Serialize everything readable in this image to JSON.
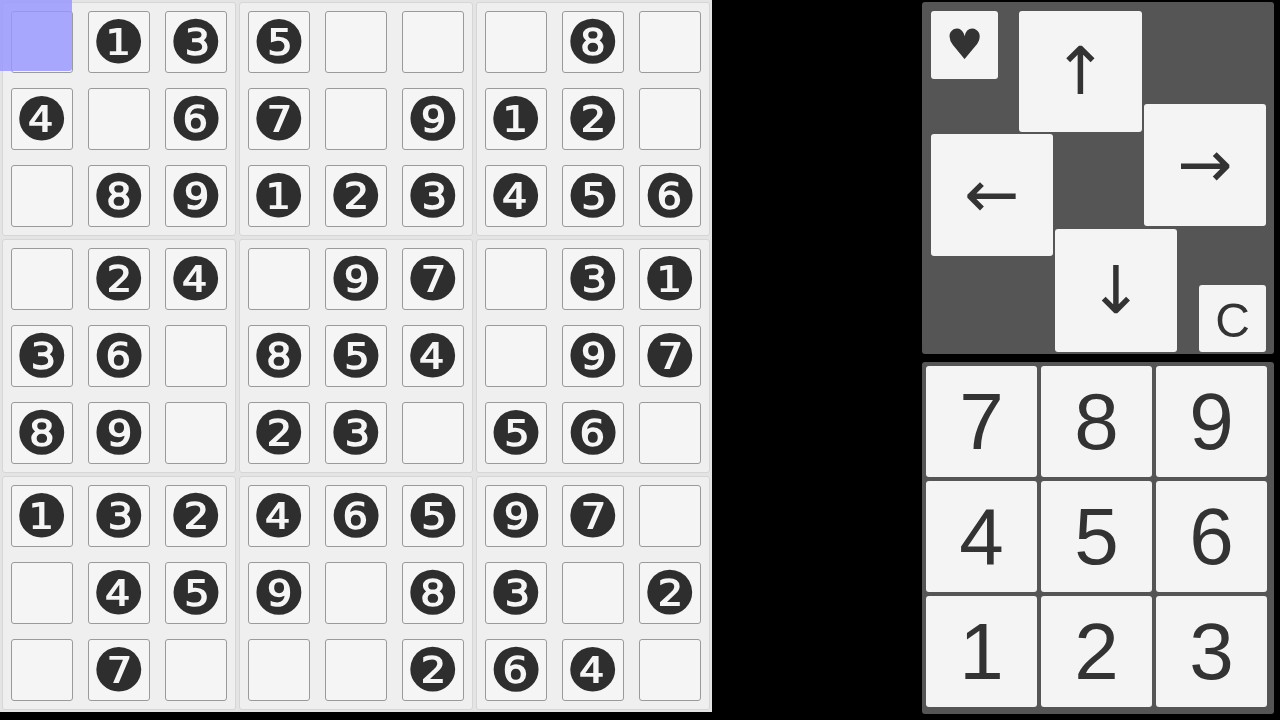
{
  "board": {
    "boxes": [
      {
        "cells": [
          {
            "selected": true
          },
          {
            "value": "❶",
            "selected": false
          },
          {
            "value": "❸",
            "selected": false
          },
          {
            "value": "❹",
            "selected": false
          },
          {
            "selected": false
          },
          {
            "value": "❻",
            "selected": false
          },
          {
            "selected": false
          },
          {
            "value": "❽",
            "selected": false
          },
          {
            "value": "❾",
            "selected": false
          }
        ]
      },
      {
        "cells": [
          {
            "value": "❺",
            "selected": false
          },
          {
            "selected": false
          },
          {
            "selected": false
          },
          {
            "value": "❼",
            "selected": false
          },
          {
            "selected": false
          },
          {
            "value": "❾",
            "selected": false
          },
          {
            "value": "❶",
            "selected": false
          },
          {
            "value": "❷",
            "selected": false
          },
          {
            "value": "❸",
            "selected": false
          }
        ]
      },
      {
        "cells": [
          {
            "selected": false
          },
          {
            "value": "❽",
            "selected": false
          },
          {
            "selected": false
          },
          {
            "value": "❶",
            "selected": false
          },
          {
            "value": "❷",
            "selected": false
          },
          {
            "selected": false
          },
          {
            "value": "❹",
            "selected": false
          },
          {
            "value": "❺",
            "selected": false
          },
          {
            "value": "❻",
            "selected": false
          }
        ]
      },
      {
        "cells": [
          {
            "selected": false
          },
          {
            "value": "❷",
            "selected": false
          },
          {
            "value": "❹",
            "selected": false
          },
          {
            "value": "❸",
            "selected": false
          },
          {
            "value": "❻",
            "selected": false
          },
          {
            "selected": false
          },
          {
            "value": "❽",
            "selected": false
          },
          {
            "value": "❾",
            "selected": false
          },
          {
            "selected": false
          }
        ]
      },
      {
        "cells": [
          {
            "selected": false
          },
          {
            "value": "❾",
            "selected": false
          },
          {
            "value": "❼",
            "selected": false
          },
          {
            "value": "❽",
            "selected": false
          },
          {
            "value": "❺",
            "selected": false
          },
          {
            "value": "❹",
            "selected": false
          },
          {
            "value": "❷",
            "selected": false
          },
          {
            "value": "❸",
            "selected": false
          },
          {
            "selected": false
          }
        ]
      },
      {
        "cells": [
          {
            "selected": false
          },
          {
            "value": "❸",
            "selected": false
          },
          {
            "value": "❶",
            "selected": false
          },
          {
            "selected": false
          },
          {
            "value": "❾",
            "selected": false
          },
          {
            "value": "❼",
            "selected": false
          },
          {
            "value": "❺",
            "selected": false
          },
          {
            "value": "❻",
            "selected": false
          },
          {
            "selected": false
          }
        ]
      },
      {
        "cells": [
          {
            "value": "❶",
            "selected": false
          },
          {
            "value": "❸",
            "selected": false
          },
          {
            "value": "❷",
            "selected": false
          },
          {
            "selected": false
          },
          {
            "value": "❹",
            "selected": false
          },
          {
            "value": "❺",
            "selected": false
          },
          {
            "selected": false
          },
          {
            "value": "❼",
            "selected": false
          },
          {
            "selected": false
          }
        ]
      },
      {
        "cells": [
          {
            "value": "❹",
            "selected": false
          },
          {
            "value": "❻",
            "selected": false
          },
          {
            "value": "❺",
            "selected": false
          },
          {
            "value": "❾",
            "selected": false
          },
          {
            "selected": false
          },
          {
            "value": "❽",
            "selected": false
          },
          {
            "selected": false
          },
          {
            "selected": false
          },
          {
            "value": "❷",
            "selected": false
          }
        ]
      },
      {
        "cells": [
          {
            "value": "❾",
            "selected": false
          },
          {
            "value": "❼",
            "selected": false
          },
          {
            "selected": false
          },
          {
            "value": "❸",
            "selected": false
          },
          {
            "selected": false
          },
          {
            "value": "❷",
            "selected": false
          },
          {
            "value": "❻",
            "selected": false
          },
          {
            "value": "❹",
            "selected": false
          },
          {
            "selected": false
          }
        ]
      }
    ]
  },
  "direction_pad": {
    "keys": [
      {
        "kind": "heart",
        "label": "♥"
      },
      {
        "kind": "up",
        "label": "↑"
      },
      {
        "kind": "left",
        "label": "←"
      },
      {
        "kind": "right",
        "label": "→"
      },
      {
        "kind": "down",
        "label": "↓"
      },
      {
        "kind": "letter",
        "label": "C"
      }
    ]
  },
  "number_pad": {
    "keys": [
      "7",
      "8",
      "9",
      "4",
      "5",
      "6",
      "1",
      "2",
      "3"
    ]
  }
}
